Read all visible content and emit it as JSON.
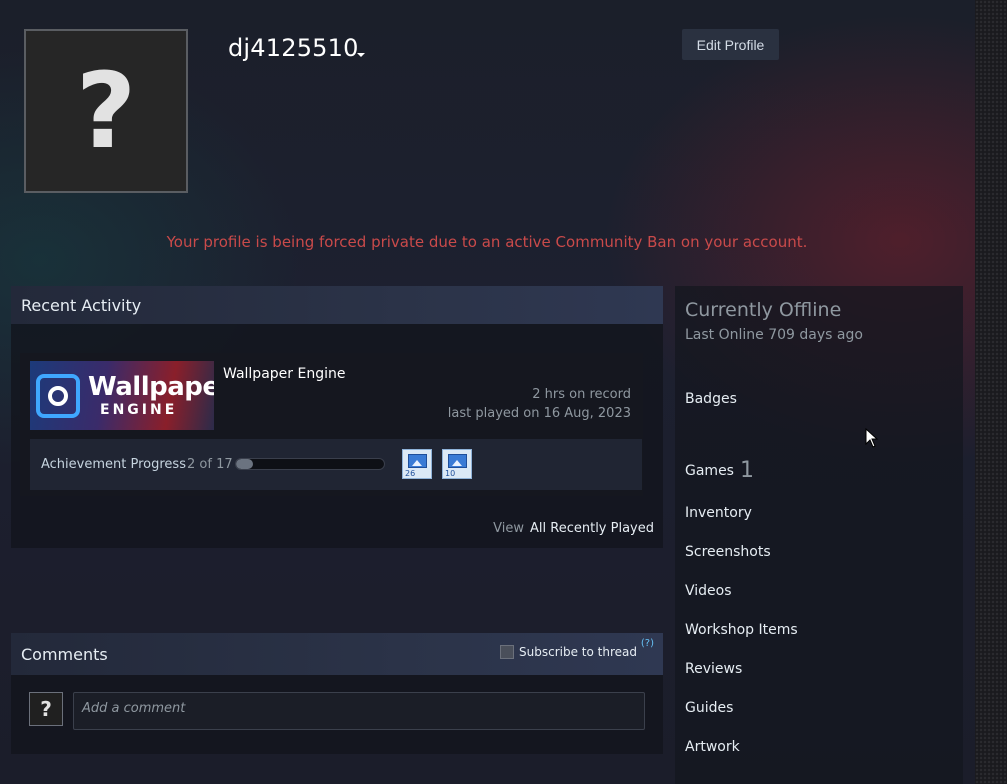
{
  "profile": {
    "avatar_glyph": "?",
    "username": "dj4125510",
    "edit_label": "Edit Profile",
    "ban_message": "Your profile is being forced private due to an active Community Ban on your account."
  },
  "recent_activity": {
    "title": "Recent Activity",
    "games": [
      {
        "capsule_line1": "Wallpaper",
        "capsule_line2": "ENGINE",
        "name": "Wallpaper Engine",
        "hours": "2 hrs on record",
        "last_played": "last played on 16 Aug, 2023",
        "achievement_label": "Achievement Progress",
        "achievement_count": "2 of 17",
        "achievement_fraction": 0.1176,
        "achievement_icons": [
          {
            "icon": "picture-icon",
            "number": "26"
          },
          {
            "icon": "picture-icon",
            "number": "10"
          }
        ]
      }
    ],
    "view_label": "View",
    "view_link": "All Recently Played"
  },
  "comments": {
    "title": "Comments",
    "subscribe_label": "Subscribe to thread",
    "help_label": "(?)",
    "avatar_glyph": "?",
    "placeholder": "Add a comment"
  },
  "side": {
    "status": "Currently Offline",
    "last_online": "Last Online 709 days ago",
    "links": {
      "badges": "Badges",
      "games": "Games",
      "games_count": "1",
      "inventory": "Inventory",
      "screenshots": "Screenshots",
      "videos": "Videos",
      "workshop": "Workshop Items",
      "reviews": "Reviews",
      "guides": "Guides",
      "artwork": "Artwork"
    }
  },
  "colors": {
    "ban_red": "#c94a4a",
    "link_blue": "#66c0f4",
    "panel_header": "#2b3348"
  }
}
